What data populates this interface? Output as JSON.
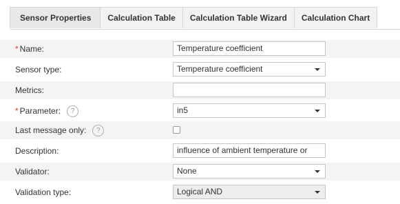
{
  "tabs": [
    {
      "label": "Sensor Properties",
      "active": true
    },
    {
      "label": "Calculation Table",
      "active": false
    },
    {
      "label": "Calculation Table Wizard",
      "active": false
    },
    {
      "label": "Calculation Chart",
      "active": false
    }
  ],
  "form": {
    "name": {
      "required_mark": "*",
      "label": "Name:",
      "value": "Temperature coefficient"
    },
    "sensor_type": {
      "label": "Sensor type:",
      "value": "Temperature coefficient"
    },
    "metrics": {
      "label": "Metrics:",
      "value": ""
    },
    "parameter": {
      "required_mark": "*",
      "label": "Parameter:",
      "help": "?",
      "value": "in5"
    },
    "last_message_only": {
      "label": "Last message only:",
      "help": "?",
      "checked": false
    },
    "description": {
      "label": "Description:",
      "value": "influence of ambient temperature or"
    },
    "validator": {
      "label": "Validator:",
      "value": "None"
    },
    "validation_type": {
      "label": "Validation type:",
      "value": "Logical AND"
    }
  },
  "colors": {
    "required": "#e53935",
    "row_shade": "#f4f4f4",
    "tab_bg": "#f2f2f2"
  }
}
